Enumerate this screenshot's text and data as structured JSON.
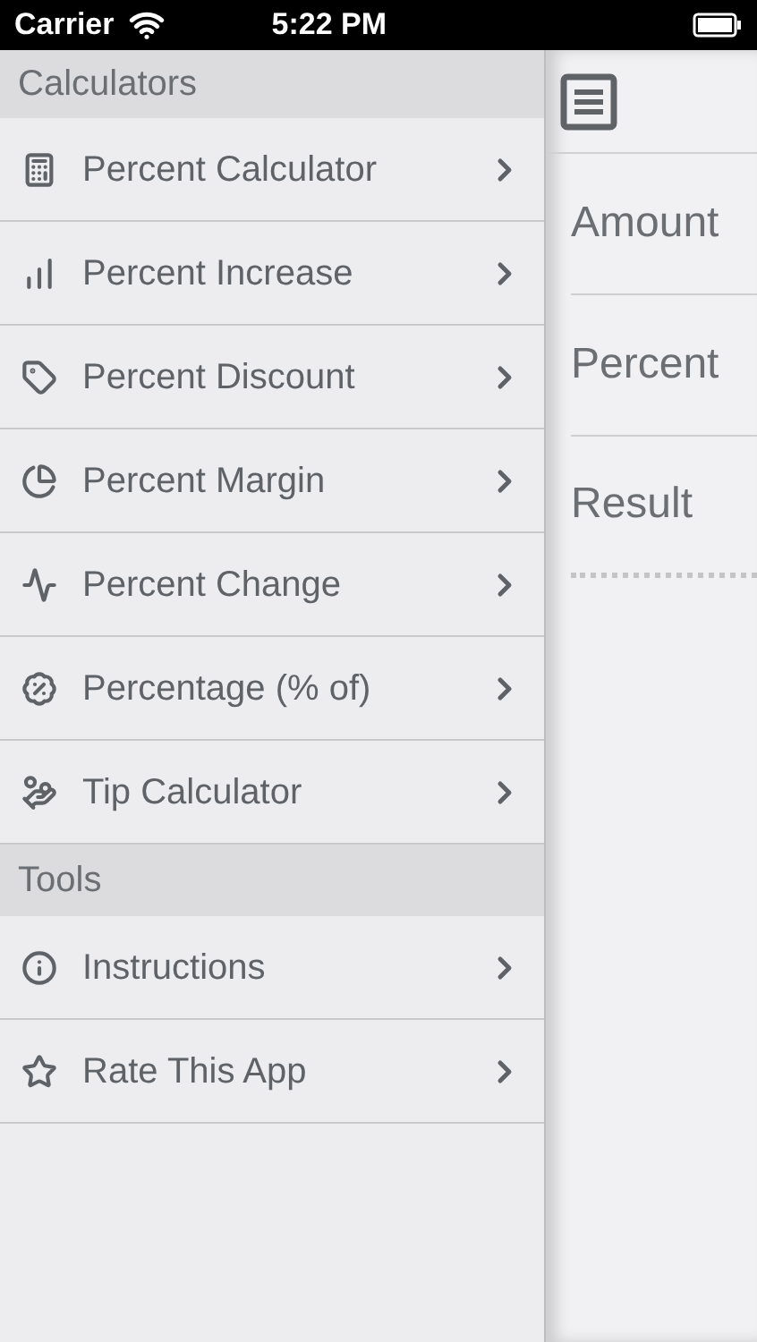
{
  "status_bar": {
    "carrier": "Carrier",
    "time": "5:22 PM"
  },
  "sidebar": {
    "sections": [
      {
        "title": "Calculators",
        "items": [
          {
            "label": "Percent Calculator"
          },
          {
            "label": "Percent Increase"
          },
          {
            "label": "Percent Discount"
          },
          {
            "label": "Percent Margin"
          },
          {
            "label": "Percent Change"
          },
          {
            "label": "Percentage (% of)"
          },
          {
            "label": "Tip Calculator"
          }
        ]
      },
      {
        "title": "Tools",
        "items": [
          {
            "label": "Instructions"
          },
          {
            "label": "Rate This App"
          }
        ]
      }
    ]
  },
  "form": {
    "fields": [
      {
        "label": "Amount"
      },
      {
        "label": "Percent"
      },
      {
        "label": "Result"
      }
    ]
  }
}
